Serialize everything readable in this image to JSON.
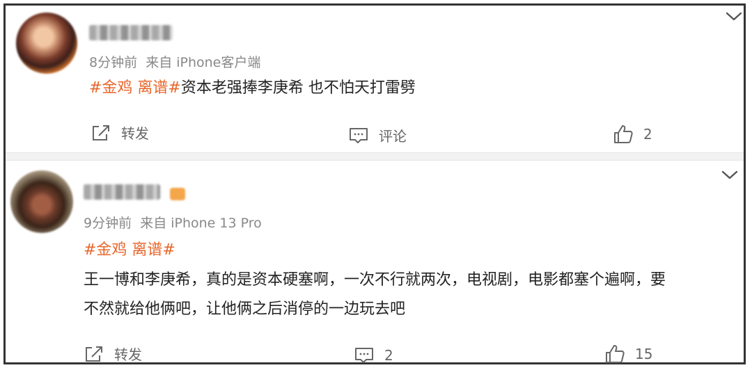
{
  "comments": [
    {
      "time": "8分钟前",
      "source": "来自 iPhone客户端",
      "tag": "#金鸡 离谱#",
      "text": "资本老强捧李庚希 也不怕天打雷劈",
      "repost_label": "转发",
      "comment_label": "评论",
      "likes": "2"
    },
    {
      "time": "9分钟前",
      "source": "来自 iPhone 13 Pro",
      "tag": "#金鸡 离谱#",
      "text_line1": "王一博和李庚希，真的是资本硬塞啊，一次不行就两次，电视剧，电影都塞个遍啊，要",
      "text_line2": "不然就给他俩吧，让他俩之后消停的一边玩去吧",
      "repost_label": "转发",
      "comment_count": "2",
      "likes": "15"
    }
  ],
  "colors": {
    "tag": "#e8662b",
    "meta": "#888888",
    "text": "#222222",
    "action": "#666666"
  },
  "icons": [
    "chevron-down-icon",
    "repost-icon",
    "comment-icon",
    "like-icon"
  ]
}
